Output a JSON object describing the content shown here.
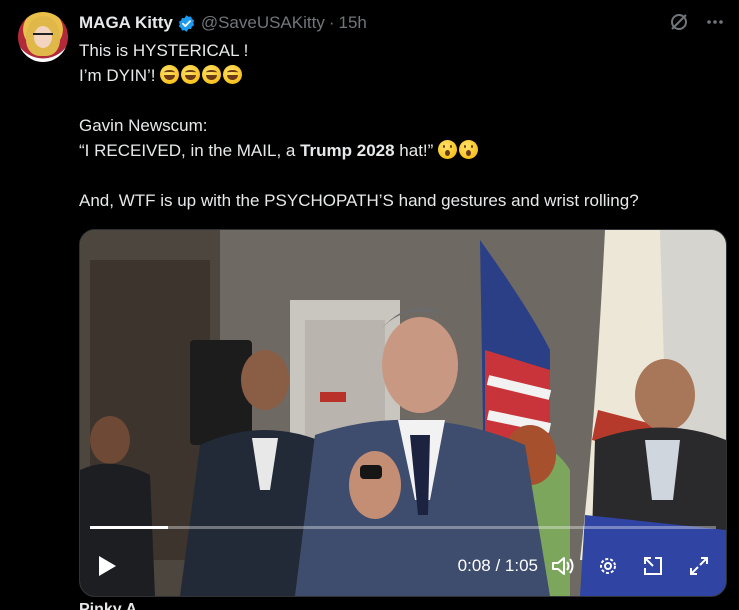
{
  "author": {
    "display_name": "MAGA Kitty",
    "handle": "@SaveUSAKitty",
    "separator": "·",
    "time": "15h"
  },
  "post": {
    "line1": "This is HYSTERICAL !",
    "line2": "I’m DYIN’!",
    "line3": "Gavin Newscum:",
    "line4_pre": "“I RECEIVED, in the MAIL, a ",
    "line4_bold": "Trump 2028",
    "line4_post": " hat!”",
    "line5": "And, WTF is up with the PSYCHOPATH’S hand gestures and wrist rolling?"
  },
  "video": {
    "time": "0:08 / 1:05",
    "progress": 0.125,
    "play_icon": "play-icon",
    "volume_icon": "volume-icon",
    "settings_icon": "settings-gear-icon",
    "pip_icon": "picture-in-picture-icon",
    "fullscreen_icon": "fullscreen-icon"
  },
  "next_post_name": "Pinky A",
  "colors": {
    "background": "#000000",
    "text": "#e7e9ea",
    "muted": "#71767b",
    "verified": "#1d9bf0"
  }
}
